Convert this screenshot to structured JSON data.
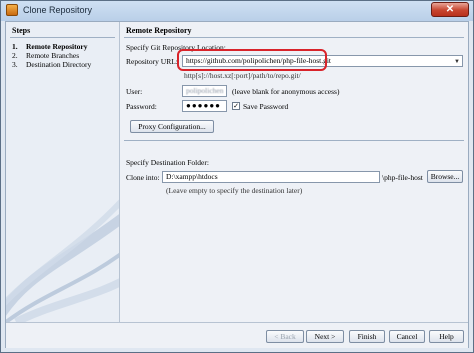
{
  "window": {
    "title": "Clone Repository",
    "close_glyph": "✕"
  },
  "steps": {
    "title": "Steps",
    "items": [
      {
        "num": "1.",
        "label": "Remote Repository",
        "active": true
      },
      {
        "num": "2.",
        "label": "Remote Branches",
        "active": false
      },
      {
        "num": "3.",
        "label": "Destination Directory",
        "active": false
      }
    ]
  },
  "remote": {
    "section_title": "Remote Repository",
    "instruction": "Specify Git Repository Location:",
    "url_label": "Repository URL:",
    "url_value": "https://github.com/polipolichen/php-file-host.git",
    "url_hint": "http[s]://host.xz[:port]/path/to/repo.git/",
    "user_label": "User:",
    "user_value": "polipolichen",
    "user_hint": "(leave blank for anonymous access)",
    "password_label": "Password:",
    "password_value": "●●●●●●",
    "save_password_label": "Save Password",
    "save_password_checked": true,
    "proxy_button": "Proxy Configuration..."
  },
  "destination": {
    "instruction": "Specify Destination Folder:",
    "clone_into_label": "Clone into:",
    "clone_into_value": "D:\\xampp\\htdocs",
    "folder_suffix": "\\php-file-host",
    "browse_button": "Browse...",
    "hint": "(Leave empty to specify the destination later)"
  },
  "footer": {
    "back": "< Back",
    "next": "Next >",
    "finish": "Finish",
    "cancel": "Cancel",
    "help": "Help"
  },
  "colors": {
    "highlight": "#d8232a",
    "window_bg": "#eef1f6",
    "title_bar": "#b9cfe8"
  }
}
